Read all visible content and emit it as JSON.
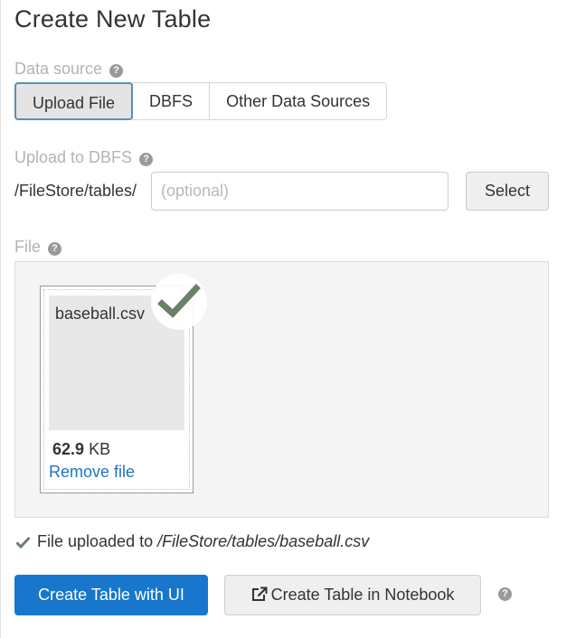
{
  "page": {
    "title": "Create New Table"
  },
  "data_source": {
    "label": "Data source",
    "tabs": [
      {
        "label": "Upload File",
        "active": true
      },
      {
        "label": "DBFS",
        "active": false
      },
      {
        "label": "Other Data Sources",
        "active": false
      }
    ]
  },
  "upload": {
    "label": "Upload to DBFS",
    "path_prefix": "/FileStore/tables/",
    "path_value": "",
    "path_placeholder": "(optional)",
    "select_label": "Select"
  },
  "file": {
    "label": "File",
    "name": "baseball.csv",
    "size_value": "62.9",
    "size_unit": "KB",
    "remove_label": "Remove file"
  },
  "status": {
    "text": "File uploaded to",
    "path": "/FileStore/tables/baseball.csv"
  },
  "actions": {
    "create_ui_label": "Create Table with UI",
    "create_notebook_label": "Create Table in Notebook"
  },
  "icons": {
    "help": "question-circle-icon",
    "check": "check-icon",
    "external_link": "external-link-icon"
  },
  "colors": {
    "accent": "#1877cc",
    "link": "#1f74c2",
    "check": "#6b7f6b",
    "active_tab_border": "#5b8fb8"
  }
}
